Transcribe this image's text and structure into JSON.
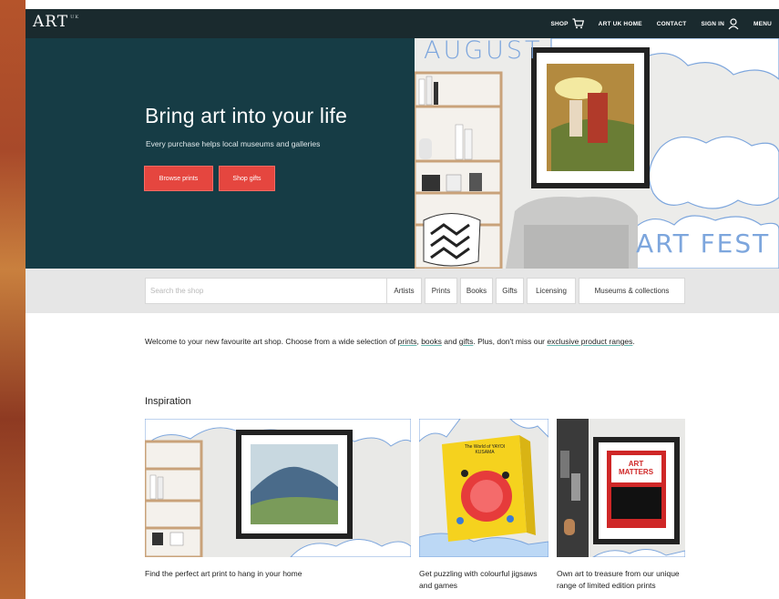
{
  "nav": {
    "logo": "ART",
    "logo_sup": "UK",
    "items": [
      "SHOP",
      "ART UK HOME",
      "CONTACT",
      "SIGN IN",
      "MENU"
    ]
  },
  "hero": {
    "title": "Bring art into your life",
    "subtitle": "Every purchase helps local museums and galleries",
    "btn_browse": "Browse prints",
    "btn_gifts": "Shop gifts",
    "banner_top": "AUGUST",
    "banner_bottom": "ART FEST"
  },
  "search": {
    "placeholder": "Search the shop",
    "tabs": [
      "Artists",
      "Prints",
      "Books",
      "Gifts",
      "Licensing",
      "Museums & collections"
    ]
  },
  "welcome": {
    "t1": "Welcome to your new favourite art shop. Choose from a wide selection of ",
    "l1": "prints",
    "t2": ", ",
    "l2": "books",
    "t3": " and ",
    "l3": "gifts",
    "t4": ". Plus, don't miss our ",
    "l4": "exclusive product ranges",
    "t5": "."
  },
  "inspiration": {
    "heading": "Inspiration",
    "cards": [
      {
        "caption": "Find the perfect art print to hang in your home"
      },
      {
        "caption": "Get puzzling with colourful jigsaws and games",
        "book_title": "The World of YAYOI KUSAMA"
      },
      {
        "caption": "Own art to treasure from our unique range of limited edition prints",
        "art_text": "ART MATTERS"
      }
    ]
  },
  "colors": {
    "nav_bg": "#1a2a2e",
    "hero_bg": "#163c45",
    "accent_red": "#e5463f",
    "banner_blue": "#7da6dd"
  }
}
